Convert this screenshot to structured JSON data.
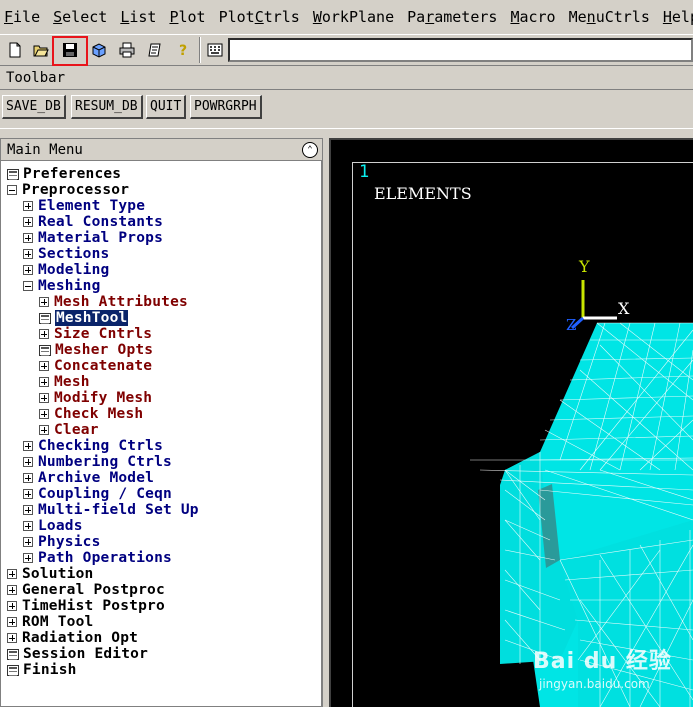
{
  "menubar": [
    {
      "pre": "",
      "u": "F",
      "post": "ile"
    },
    {
      "pre": "",
      "u": "S",
      "post": "elect"
    },
    {
      "pre": "",
      "u": "L",
      "post": "ist"
    },
    {
      "pre": "",
      "u": "P",
      "post": "lot"
    },
    {
      "pre": "Plot",
      "u": "C",
      "post": "trls"
    },
    {
      "pre": "",
      "u": "W",
      "post": "orkPlane"
    },
    {
      "pre": "Pa",
      "u": "r",
      "post": "ameters"
    },
    {
      "pre": "",
      "u": "M",
      "post": "acro"
    },
    {
      "pre": "Me",
      "u": "n",
      "post": "uCtrls"
    },
    {
      "pre": "",
      "u": "H",
      "post": "elp"
    }
  ],
  "iconbar": {
    "icons": [
      "new-file-icon",
      "open-folder-icon",
      "save-icon",
      "cube-icon",
      "print-icon",
      "report-icon",
      "help-icon",
      "keyboard-icon"
    ],
    "command_value": ""
  },
  "toolbar": {
    "label": "Toolbar",
    "buttons": [
      "SAVE_DB",
      "RESUM_DB",
      "QUIT",
      "POWRGRPH"
    ]
  },
  "main_menu": {
    "title": "Main Menu",
    "items": [
      {
        "label": "Preferences",
        "icon": "doc",
        "level": 0,
        "color": "black"
      },
      {
        "label": "Preprocessor",
        "icon": "minus",
        "level": 0,
        "color": "black"
      },
      {
        "label": "Element Type",
        "icon": "plus",
        "level": 1,
        "color": "blue"
      },
      {
        "label": "Real Constants",
        "icon": "plus",
        "level": 1,
        "color": "blue"
      },
      {
        "label": "Material Props",
        "icon": "plus",
        "level": 1,
        "color": "blue"
      },
      {
        "label": "Sections",
        "icon": "plus",
        "level": 1,
        "color": "blue"
      },
      {
        "label": "Modeling",
        "icon": "plus",
        "level": 1,
        "color": "blue"
      },
      {
        "label": "Meshing",
        "icon": "minus",
        "level": 1,
        "color": "blue"
      },
      {
        "label": "Mesh Attributes",
        "icon": "plus",
        "level": 2,
        "color": "red"
      },
      {
        "label": "MeshTool",
        "icon": "doc",
        "level": 2,
        "color": "red",
        "selected": true
      },
      {
        "label": "Size Cntrls",
        "icon": "plus",
        "level": 2,
        "color": "red"
      },
      {
        "label": "Mesher Opts",
        "icon": "doc",
        "level": 2,
        "color": "red"
      },
      {
        "label": "Concatenate",
        "icon": "plus",
        "level": 2,
        "color": "red"
      },
      {
        "label": "Mesh",
        "icon": "plus",
        "level": 2,
        "color": "red"
      },
      {
        "label": "Modify Mesh",
        "icon": "plus",
        "level": 2,
        "color": "red"
      },
      {
        "label": "Check Mesh",
        "icon": "plus",
        "level": 2,
        "color": "red"
      },
      {
        "label": "Clear",
        "icon": "plus",
        "level": 2,
        "color": "red"
      },
      {
        "label": "Checking Ctrls",
        "icon": "plus",
        "level": 1,
        "color": "blue"
      },
      {
        "label": "Numbering Ctrls",
        "icon": "plus",
        "level": 1,
        "color": "blue"
      },
      {
        "label": "Archive Model",
        "icon": "plus",
        "level": 1,
        "color": "blue"
      },
      {
        "label": "Coupling / Ceqn",
        "icon": "plus",
        "level": 1,
        "color": "blue"
      },
      {
        "label": "Multi-field Set Up",
        "icon": "plus",
        "level": 1,
        "color": "blue"
      },
      {
        "label": "Loads",
        "icon": "plus",
        "level": 1,
        "color": "blue"
      },
      {
        "label": "Physics",
        "icon": "plus",
        "level": 1,
        "color": "blue"
      },
      {
        "label": "Path Operations",
        "icon": "plus",
        "level": 1,
        "color": "blue"
      },
      {
        "label": "Solution",
        "icon": "plus",
        "level": 0,
        "color": "black"
      },
      {
        "label": "General Postproc",
        "icon": "plus",
        "level": 0,
        "color": "black"
      },
      {
        "label": "TimeHist Postpro",
        "icon": "plus",
        "level": 0,
        "color": "black"
      },
      {
        "label": "ROM Tool",
        "icon": "plus",
        "level": 0,
        "color": "black"
      },
      {
        "label": "Radiation Opt",
        "icon": "plus",
        "level": 0,
        "color": "black"
      },
      {
        "label": "Session Editor",
        "icon": "doc",
        "level": 0,
        "color": "black"
      },
      {
        "label": "Finish",
        "icon": "doc",
        "level": 0,
        "color": "black"
      }
    ]
  },
  "graphics": {
    "window_number": "1",
    "plot_title": "ELEMENTS",
    "axis_y": "Y",
    "axis_x": "X",
    "axis_z": "Z",
    "mesh_color": "#00e5e5"
  },
  "watermark": {
    "logo": "Bai du 经验",
    "url": "jingyan.baidu.com"
  }
}
